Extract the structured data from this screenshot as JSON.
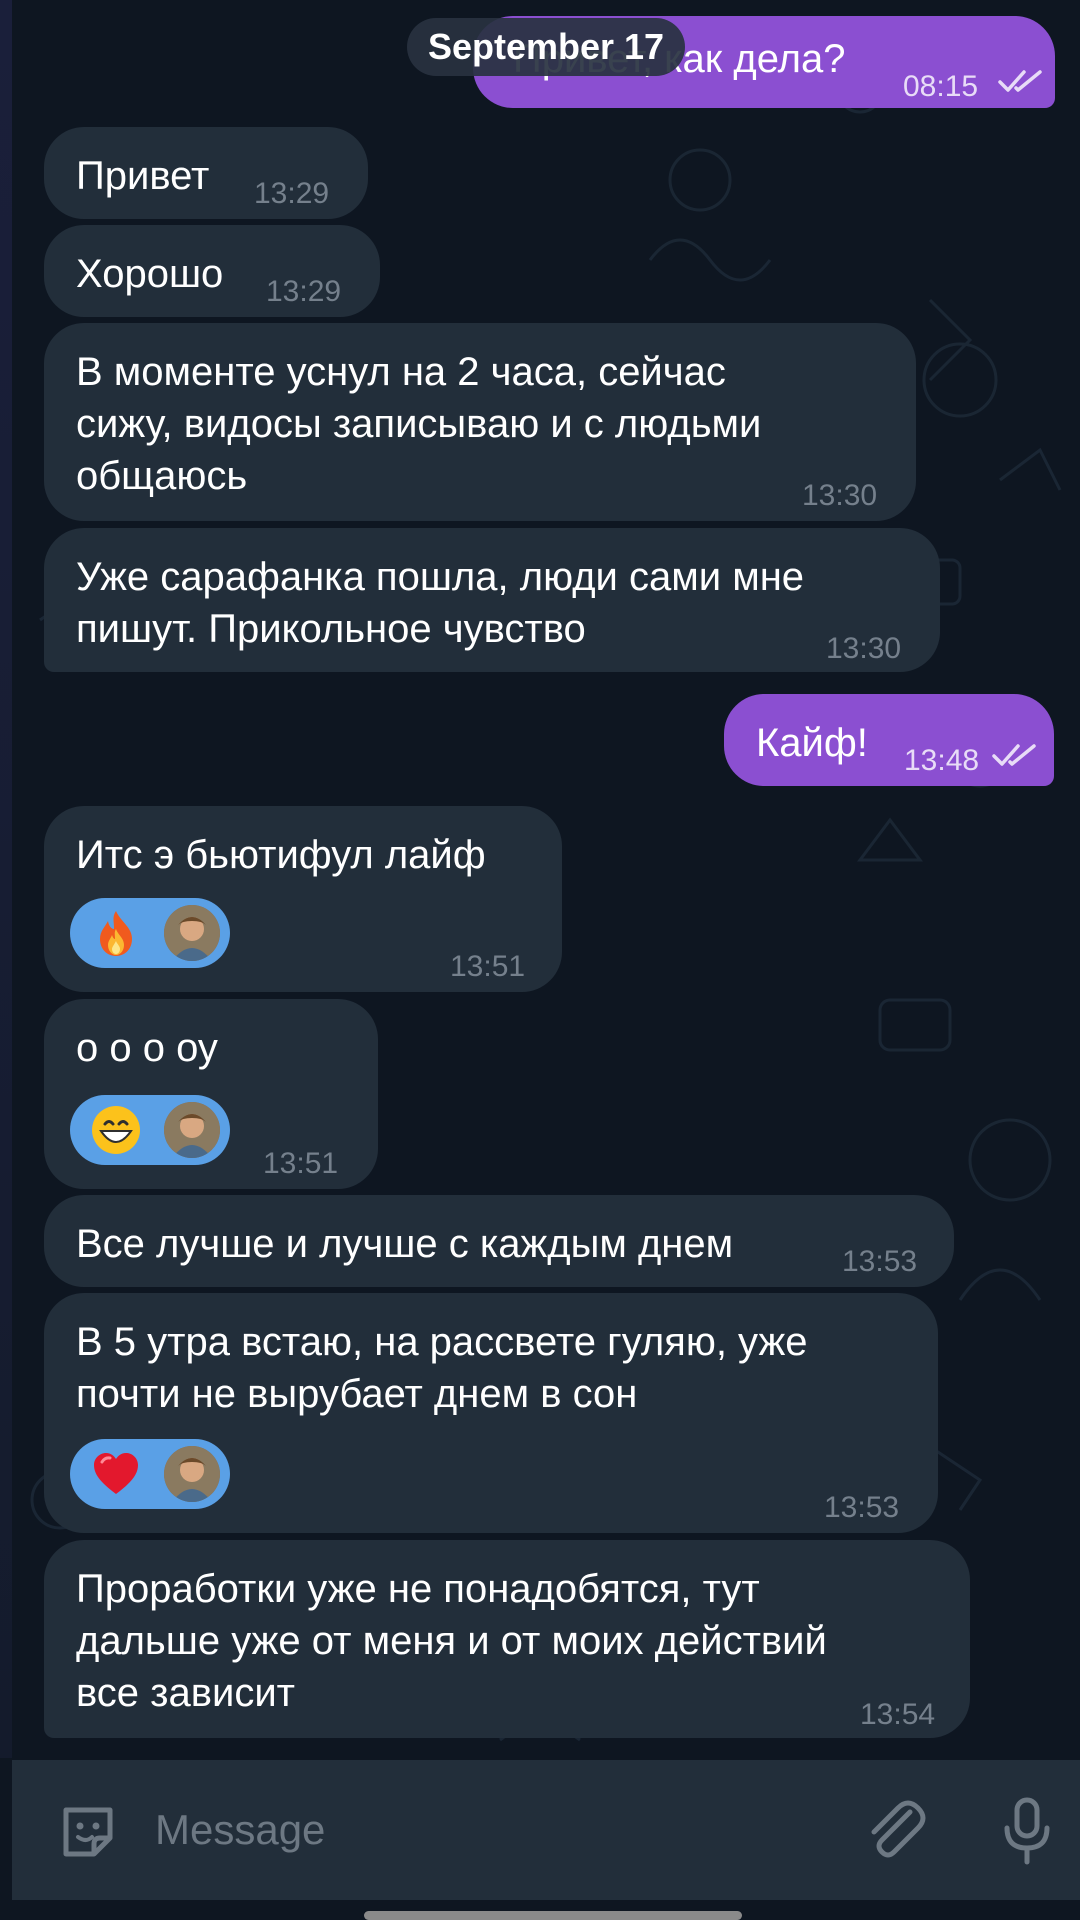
{
  "date_separator": "September 17",
  "messages": [
    {
      "dir": "out",
      "text": [
        "Привет, как дела?"
      ],
      "time": "08:15",
      "read": true
    },
    {
      "dir": "in",
      "text": [
        "Привет"
      ],
      "time": "13:29"
    },
    {
      "dir": "in",
      "text": [
        "Хорошо"
      ],
      "time": "13:29"
    },
    {
      "dir": "in",
      "text": [
        "В моменте уснул на 2 часа, сейчас",
        "сижу, видосы записываю и с людьми",
        "общаюсь"
      ],
      "time": "13:30"
    },
    {
      "dir": "in",
      "text": [
        "Уже сарафанка пошла, люди сами мне",
        "пишут. Прикольное чувство"
      ],
      "time": "13:30"
    },
    {
      "dir": "out",
      "text": [
        "Кайф!"
      ],
      "time": "13:48",
      "read": true
    },
    {
      "dir": "in",
      "text": [
        "Итс э бьютифул лайф"
      ],
      "time": "13:51",
      "reaction": "fire-emoji"
    },
    {
      "dir": "in",
      "text": [
        "о о о оу"
      ],
      "time": "13:51",
      "reaction": "grin-emoji"
    },
    {
      "dir": "in",
      "text": [
        "Все лучше и лучше с каждым днем"
      ],
      "time": "13:53"
    },
    {
      "dir": "in",
      "text": [
        "В 5 утра встаю, на рассвете гуляю, уже",
        "почти не вырубает днем в сон"
      ],
      "time": "13:53",
      "reaction": "heart-emoji"
    },
    {
      "dir": "in",
      "text": [
        "Проработки уже не понадобятся, тут",
        "дальше уже от меня и от моих действий",
        "все зависит"
      ],
      "time": "13:54"
    }
  ],
  "input": {
    "placeholder": "Message"
  },
  "colors": {
    "background": "#0e1621",
    "incoming_bubble": "#222e3a",
    "outgoing_bubble": "#8b4fd1",
    "reaction_pill": "#5aa0e6",
    "timestamp": "#75808c"
  },
  "icons": {
    "emoji": "sticker-smile-icon",
    "attach": "paperclip-icon",
    "voice": "microphone-icon",
    "read_status": "double-check-icon"
  }
}
